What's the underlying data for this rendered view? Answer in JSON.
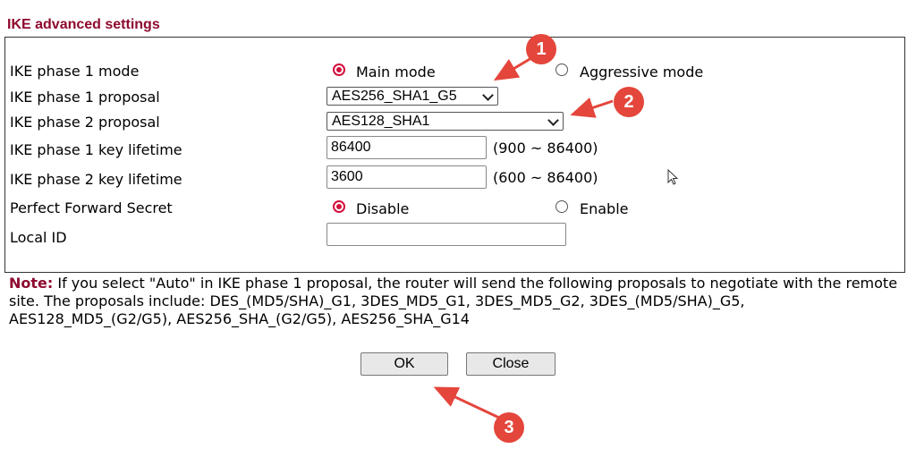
{
  "header": {
    "title": "IKE advanced settings"
  },
  "rows": {
    "phase1_mode": {
      "label": "IKE phase 1 mode",
      "option_main": "Main mode",
      "option_aggressive": "Aggressive mode",
      "selected": "Main mode"
    },
    "phase1_proposal": {
      "label": "IKE phase 1 proposal",
      "value": "AES256_SHA1_G5"
    },
    "phase2_proposal": {
      "label": "IKE phase 2 proposal",
      "value": "AES128_SHA1"
    },
    "phase1_lifetime": {
      "label": "IKE phase 1 key lifetime",
      "value": "86400",
      "range": "(900 ~ 86400)"
    },
    "phase2_lifetime": {
      "label": "IKE phase 2 key lifetime",
      "value": "3600",
      "range": "(600 ~ 86400)"
    },
    "pfs": {
      "label": "Perfect Forward Secret",
      "option_disable": "Disable",
      "option_enable": "Enable",
      "selected": "Disable"
    },
    "local_id": {
      "label": "Local ID",
      "value": ""
    }
  },
  "note": {
    "label": "Note:",
    "text": " If you select \"Auto\" in IKE phase 1 proposal, the router will send the following proposals to negotiate with the remote site. The proposals include: DES_(MD5/SHA)_G1, 3DES_MD5_G1, 3DES_MD5_G2, 3DES_(MD5/SHA)_G5, AES128_MD5_(G2/G5), AES256_SHA_(G2/G5), AES256_SHA_G14"
  },
  "buttons": {
    "ok": "OK",
    "close": "Close"
  },
  "annotations": {
    "badge1": "1",
    "badge2": "2",
    "badge3": "3"
  },
  "colors": {
    "accent": "#d40f3b",
    "title": "#8e0a2e",
    "annotation": "#e4463b"
  },
  "icons": {
    "cursor": "mouse-pointer-icon"
  }
}
